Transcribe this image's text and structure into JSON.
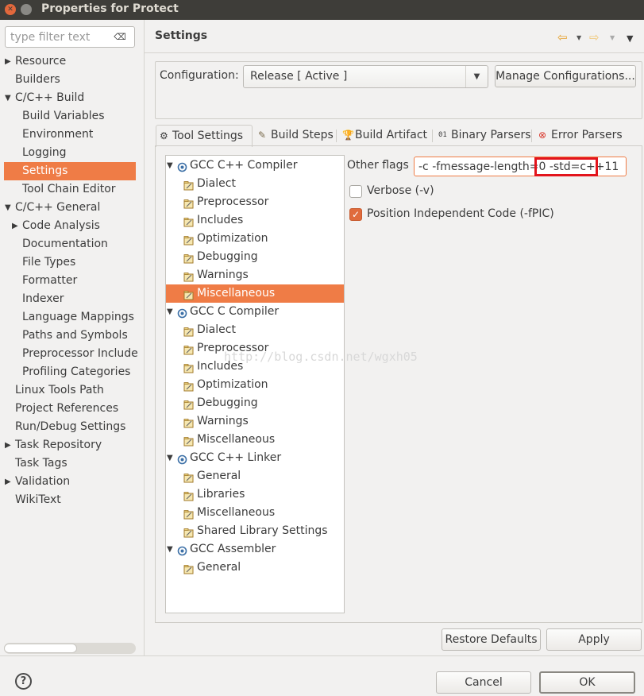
{
  "window": {
    "title": "Properties for Protect"
  },
  "filter": {
    "placeholder": "type filter text"
  },
  "nav": [
    {
      "label": "Resource",
      "level": 0,
      "expand": "collapsed"
    },
    {
      "label": "Builders",
      "level": 0,
      "expand": "none"
    },
    {
      "label": "C/C++ Build",
      "level": 0,
      "expand": "expanded"
    },
    {
      "label": "Build Variables",
      "level": 1,
      "expand": "none"
    },
    {
      "label": "Environment",
      "level": 1,
      "expand": "none"
    },
    {
      "label": "Logging",
      "level": 1,
      "expand": "none"
    },
    {
      "label": "Settings",
      "level": 1,
      "expand": "none",
      "selected": true
    },
    {
      "label": "Tool Chain Editor",
      "level": 1,
      "expand": "none"
    },
    {
      "label": "C/C++ General",
      "level": 0,
      "expand": "expanded"
    },
    {
      "label": "Code Analysis",
      "level": 1,
      "expand": "collapsed"
    },
    {
      "label": "Documentation",
      "level": 1,
      "expand": "none"
    },
    {
      "label": "File Types",
      "level": 1,
      "expand": "none"
    },
    {
      "label": "Formatter",
      "level": 1,
      "expand": "none"
    },
    {
      "label": "Indexer",
      "level": 1,
      "expand": "none"
    },
    {
      "label": "Language Mappings",
      "level": 1,
      "expand": "none"
    },
    {
      "label": "Paths and Symbols",
      "level": 1,
      "expand": "none"
    },
    {
      "label": "Preprocessor Include",
      "level": 1,
      "expand": "none"
    },
    {
      "label": "Profiling Categories",
      "level": 1,
      "expand": "none"
    },
    {
      "label": "Linux Tools Path",
      "level": 0,
      "expand": "none"
    },
    {
      "label": "Project References",
      "level": 0,
      "expand": "none"
    },
    {
      "label": "Run/Debug Settings",
      "level": 0,
      "expand": "none"
    },
    {
      "label": "Task Repository",
      "level": 0,
      "expand": "collapsed"
    },
    {
      "label": "Task Tags",
      "level": 0,
      "expand": "none"
    },
    {
      "label": "Validation",
      "level": 0,
      "expand": "collapsed"
    },
    {
      "label": "WikiText",
      "level": 0,
      "expand": "none"
    }
  ],
  "page": {
    "title": "Settings"
  },
  "config": {
    "label": "Configuration:",
    "value": "Release  [ Active ]",
    "manage_label": "Manage Configurations..."
  },
  "tabs": [
    {
      "label": "Tool Settings",
      "icon": "tool-settings-icon",
      "active": true
    },
    {
      "label": "Build Steps",
      "icon": "build-steps-icon"
    },
    {
      "label": "Build Artifact",
      "icon": "build-artifact-icon"
    },
    {
      "label": "Binary Parsers",
      "icon": "binary-parsers-icon"
    },
    {
      "label": "Error Parsers",
      "icon": "error-parsers-icon"
    }
  ],
  "tool_tree": [
    {
      "label": "GCC C++ Compiler",
      "type": "tool"
    },
    {
      "label": "Dialect",
      "type": "option"
    },
    {
      "label": "Preprocessor",
      "type": "option"
    },
    {
      "label": "Includes",
      "type": "option"
    },
    {
      "label": "Optimization",
      "type": "option"
    },
    {
      "label": "Debugging",
      "type": "option"
    },
    {
      "label": "Warnings",
      "type": "option"
    },
    {
      "label": "Miscellaneous",
      "type": "option",
      "selected": true
    },
    {
      "label": "GCC C Compiler",
      "type": "tool"
    },
    {
      "label": "Dialect",
      "type": "option"
    },
    {
      "label": "Preprocessor",
      "type": "option"
    },
    {
      "label": "Includes",
      "type": "option"
    },
    {
      "label": "Optimization",
      "type": "option"
    },
    {
      "label": "Debugging",
      "type": "option"
    },
    {
      "label": "Warnings",
      "type": "option"
    },
    {
      "label": "Miscellaneous",
      "type": "option"
    },
    {
      "label": "GCC C++ Linker",
      "type": "tool"
    },
    {
      "label": "General",
      "type": "option"
    },
    {
      "label": "Libraries",
      "type": "option"
    },
    {
      "label": "Miscellaneous",
      "type": "option"
    },
    {
      "label": "Shared Library Settings",
      "type": "option"
    },
    {
      "label": "GCC Assembler",
      "type": "tool"
    },
    {
      "label": "General",
      "type": "option"
    }
  ],
  "options": {
    "other_flags_label": "Other flags",
    "other_flags_value": "-c -fmessage-length=0 -std=c++11",
    "verbose_label": "Verbose (-v)",
    "verbose_checked": false,
    "pic_label": "Position Independent Code (-fPIC)",
    "pic_checked": true
  },
  "buttons": {
    "restore_defaults": "Restore Defaults",
    "apply": "Apply",
    "cancel": "Cancel",
    "ok": "OK"
  },
  "watermark": "http://blog.csdn.net/wgxh05",
  "colors": {
    "selection": "#ef7c46",
    "highlight_box": "#e3141c",
    "titlebar": "#3e3d39"
  }
}
